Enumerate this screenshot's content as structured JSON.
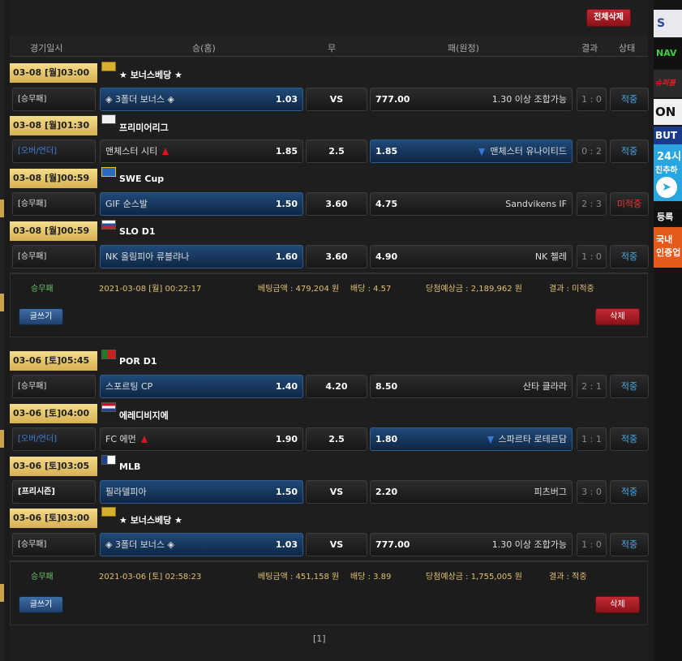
{
  "toolbar": {
    "delete_all": "전체삭제"
  },
  "columns": {
    "time": "경기일시",
    "home": "승(홈)",
    "draw": "무",
    "away": "패(원정)",
    "result": "결과",
    "status": "상태"
  },
  "buttons": {
    "write": "글쓰기",
    "delete": "삭제"
  },
  "slips": [
    {
      "games": [
        {
          "date": "03-08 [월]03:00",
          "league": "★ 보너스베당 ★",
          "type": "[승무패]",
          "home": "◈ 3폴더 보너스 ◈",
          "home_odds": "1.03",
          "draw": "VS",
          "away_odds": "777.00",
          "away": "1.30 이상 조합가능",
          "score": "1 : 0",
          "status": "적중"
        },
        {
          "date": "03-08 [월]01:30",
          "league": "프리미어리그",
          "type": "[오버/언더]",
          "home": "맨체스터 시티",
          "home_odds": "1.85",
          "draw": "2.5",
          "away_odds": "1.85",
          "away": "맨체스터 유나이티드",
          "score": "0 : 2",
          "status": "적중"
        },
        {
          "date": "03-08 [월]00:59",
          "league": "SWE Cup",
          "type": "[승무패]",
          "home": "GIF 순스발",
          "home_odds": "1.50",
          "draw": "3.60",
          "away_odds": "4.75",
          "away": "Sandvikens IF",
          "score": "2 : 3",
          "status": "미적중"
        },
        {
          "date": "03-08 [월]00:59",
          "league": "SLO D1",
          "type": "[승무패]",
          "home": "NK 올림피아 류블랴나",
          "home_odds": "1.60",
          "draw": "3.60",
          "away_odds": "4.90",
          "away": "NK 첼레",
          "score": "1 : 0",
          "status": "적중"
        }
      ],
      "summary": {
        "kind": "승무패",
        "datetime": "2021-03-08 [월] 00:22:17",
        "bet": "베팅금액 : 479,204 원",
        "odds": "배당 : 4.57",
        "expected": "당첨예상금 : 2,189,962 원",
        "result": "결과 : 미적중"
      }
    },
    {
      "games": [
        {
          "date": "03-06 [토]05:45",
          "league": "POR D1",
          "type": "[승무패]",
          "home": "스포르팅 CP",
          "home_odds": "1.40",
          "draw": "4.20",
          "away_odds": "8.50",
          "away": "산타 클라라",
          "score": "2 : 1",
          "status": "적중"
        },
        {
          "date": "03-06 [토]04:00",
          "league": "에레디비지에",
          "type": "[오버/언더]",
          "home": "FC 에먼",
          "home_odds": "1.90",
          "draw": "2.5",
          "away_odds": "1.80",
          "away": "스파르타 로테르담",
          "score": "1 : 1",
          "status": "적중"
        },
        {
          "date": "03-06 [토]03:05",
          "league": "MLB",
          "type": "[프리시즌]",
          "home": "필라델피아",
          "home_odds": "1.50",
          "draw": "VS",
          "away_odds": "2.20",
          "away": "피츠버그",
          "score": "3 : 0",
          "status": "적중"
        },
        {
          "date": "03-06 [토]03:00",
          "league": "★ 보너스베당 ★",
          "type": "[승무패]",
          "home": "◈ 3폴더 보너스 ◈",
          "home_odds": "1.03",
          "draw": "VS",
          "away_odds": "777.00",
          "away": "1.30 이상 조합가능",
          "score": "1 : 0",
          "status": "적중"
        }
      ],
      "summary": {
        "kind": "승무패",
        "datetime": "2021-03-06 [토] 02:58:23",
        "bet": "베팅금액 : 451,158 원",
        "odds": "배당 : 3.89",
        "expected": "당첨예상금 : 1,755,005 원",
        "result": "결과 : 적중"
      }
    }
  ],
  "pagination": {
    "current": "[1]"
  },
  "sidebar": {
    "items": [
      "S",
      "NAV",
      "슈퍼볼",
      "ON",
      "BUT",
      "24시",
      "친추하",
      "등록",
      "국내",
      "인증업"
    ]
  },
  "colors": {
    "gold": "#d6b152",
    "selected": "#1f4a78",
    "win": "#49a8e8",
    "lose": "#e33333",
    "summary_label": "#6ec46e"
  }
}
